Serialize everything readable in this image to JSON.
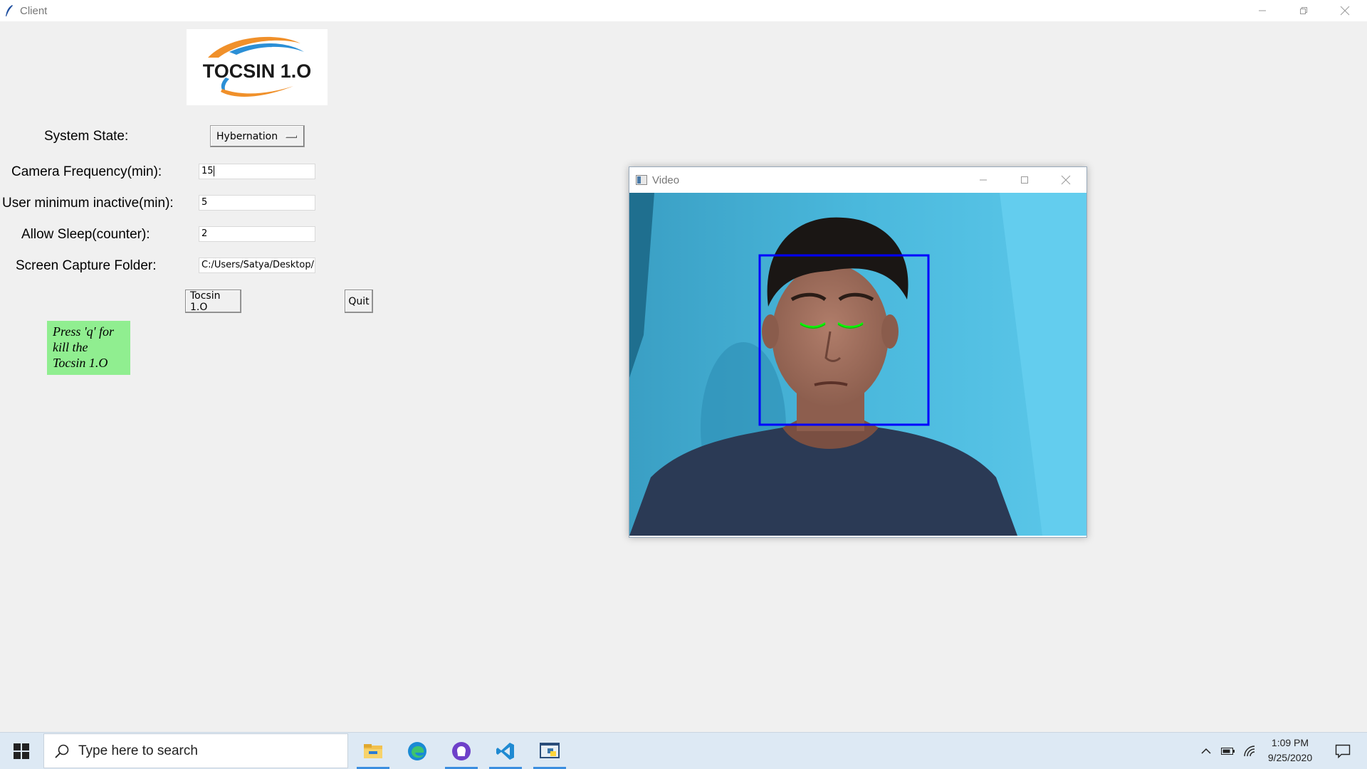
{
  "window": {
    "title": "Client"
  },
  "logo": {
    "text": "TOCSIN 1.O"
  },
  "form": {
    "system_state_label": "System State:",
    "system_state_value": "Hybernation",
    "camera_frequency_label": "Camera Frequency(min):",
    "camera_frequency_value": "15",
    "user_min_inactive_label": "User minimum inactive(min):",
    "user_min_inactive_value": "5",
    "allow_sleep_label": "Allow Sleep(counter):",
    "allow_sleep_value": "2",
    "screen_capture_label": "Screen Capture Folder:",
    "screen_capture_value": "C:/Users/Satya/Desktop/"
  },
  "buttons": {
    "tocsin": "Tocsin 1.O",
    "quit": "Quit"
  },
  "note": {
    "line1": "Press 'q' for",
    "line2": "kill the",
    "line3": "Tocsin 1.O"
  },
  "video_window": {
    "title": "Video"
  },
  "taskbar": {
    "search_placeholder": "Type here to search",
    "apps": [
      "file-explorer-icon",
      "edge-icon",
      "github-desktop-icon",
      "vscode-icon",
      "python-idle-icon"
    ],
    "time": "1:09 PM",
    "date": "9/25/2020"
  },
  "colors": {
    "face_box": "#0000ff",
    "eye_contours": "#00ff00",
    "note_bg": "#90ee90",
    "taskbar_bg": "#dde9f4"
  }
}
